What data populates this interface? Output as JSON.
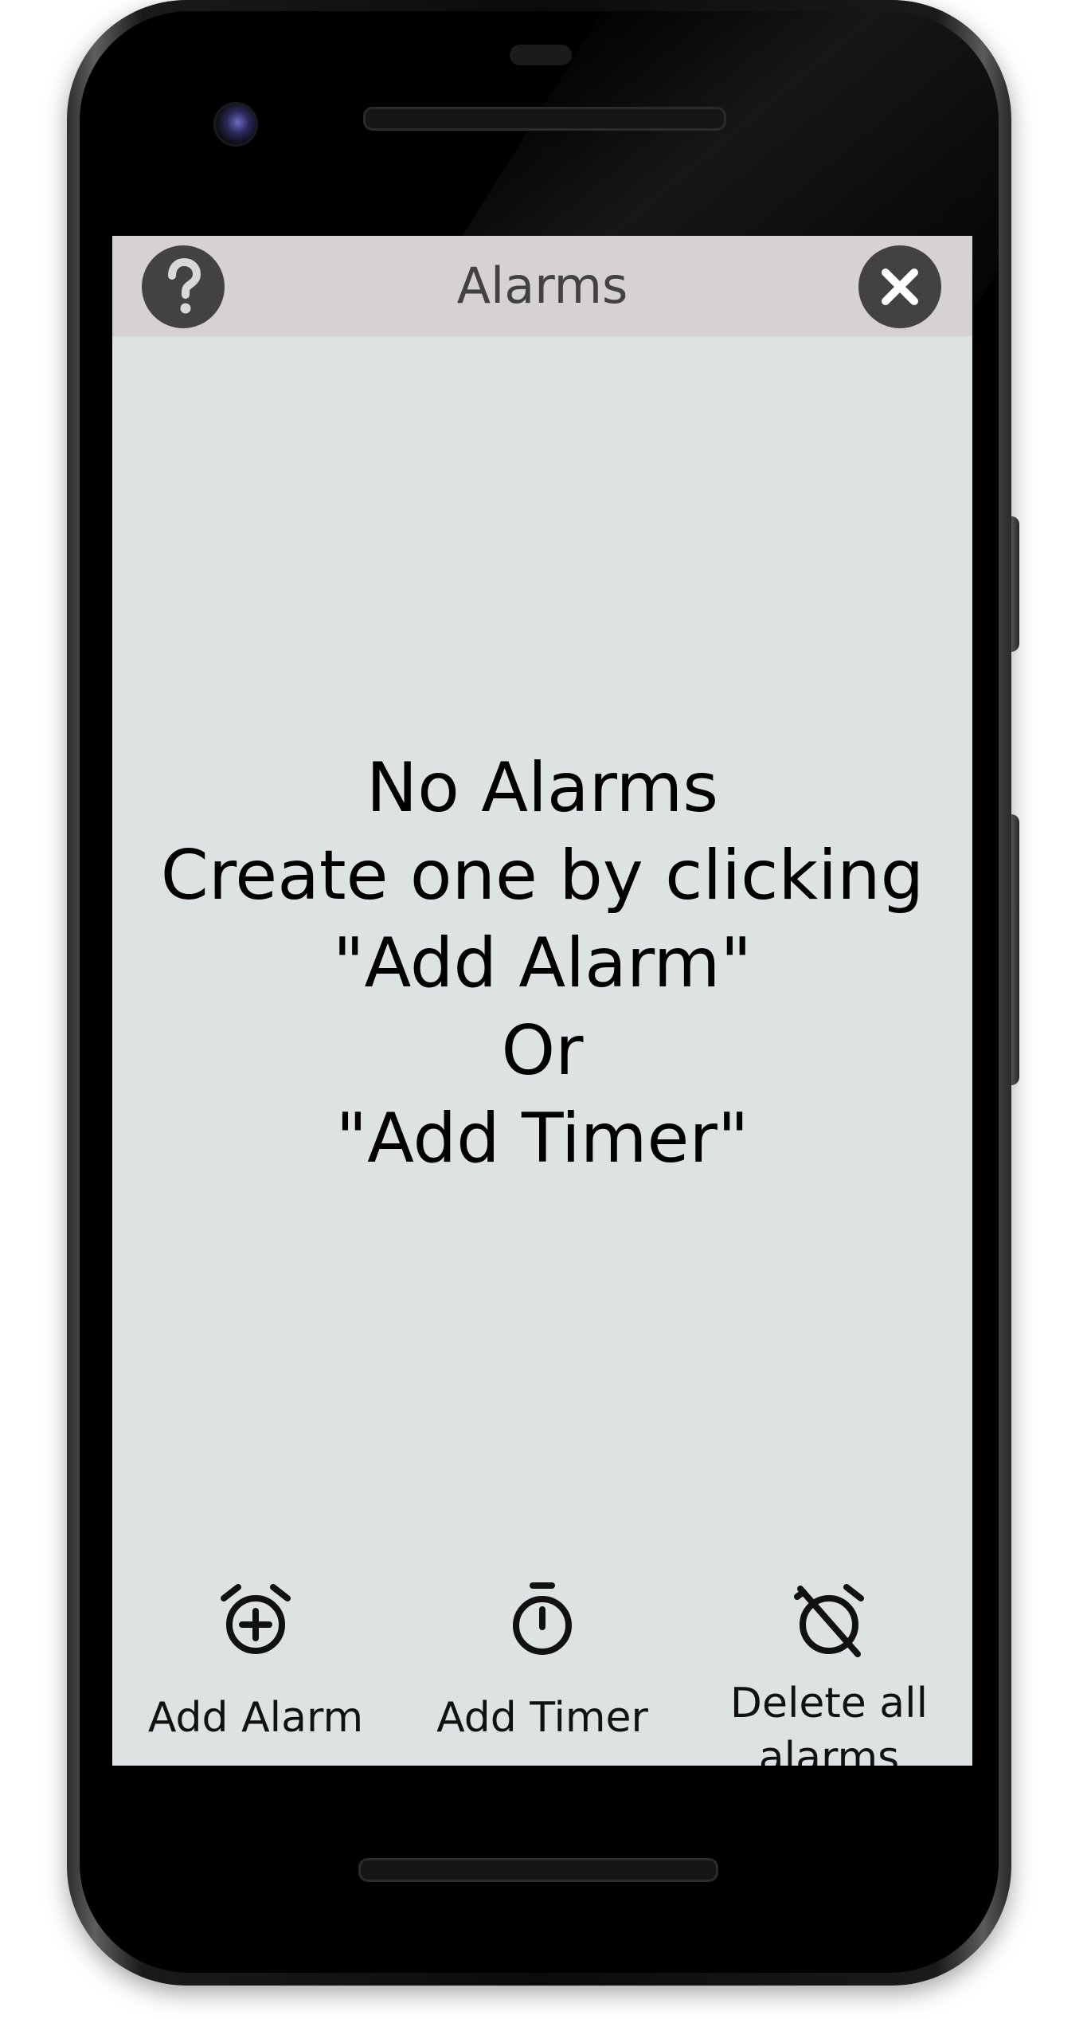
{
  "device": {
    "frame_color": "#0b0b0b",
    "screen_bg": "#dde2e3",
    "header_bg": "#d6d2d2",
    "header_button_color": "#424242"
  },
  "header": {
    "title": "Alarms",
    "help_icon": "help-circle-icon",
    "close_icon": "close-circle-icon"
  },
  "empty_state": {
    "lines": [
      "No Alarms",
      "Create one by clicking",
      "\"Add Alarm\"",
      "Or",
      "\"Add Timer\""
    ]
  },
  "bottom_actions": [
    {
      "label": "Add Alarm",
      "icon": "alarm-add-icon"
    },
    {
      "label": "Add Timer",
      "icon": "timer-icon"
    },
    {
      "label": "Delete all alarms",
      "icon": "alarm-off-icon"
    }
  ]
}
